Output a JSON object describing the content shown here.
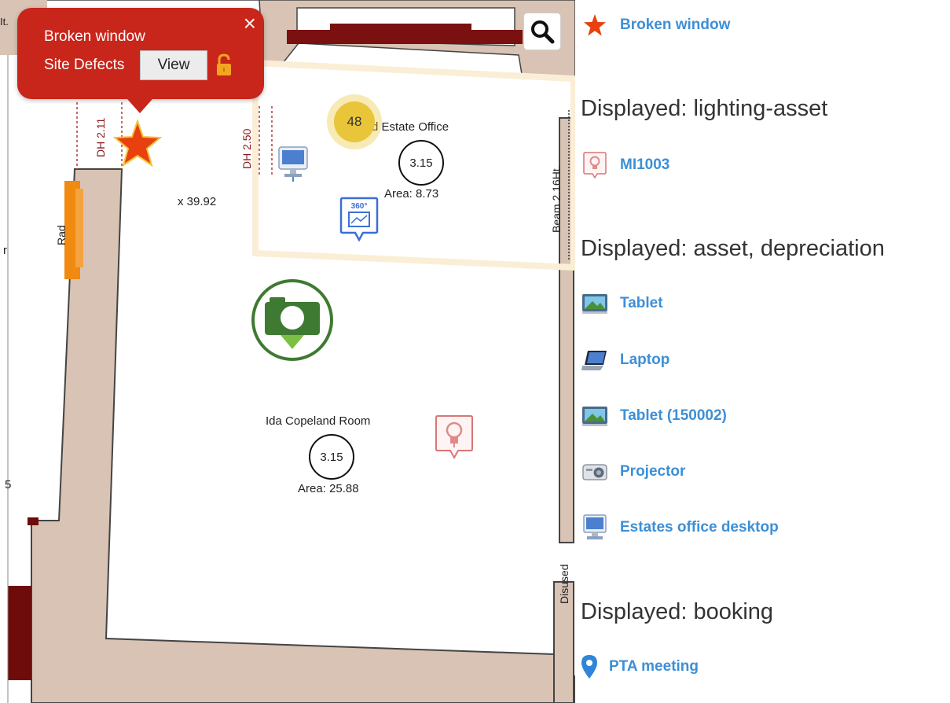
{
  "map": {
    "rooms": [
      {
        "name": "Old Estate Office",
        "value": "3.15",
        "area": "Area: 8.73"
      },
      {
        "name": "Ida Copeland Room",
        "value": "3.15",
        "area": "Area: 25.88"
      }
    ],
    "cluster_count": "48",
    "labels": {
      "dh_left": "DH 2.11",
      "dh_right": "DH 2.50",
      "beam": "Beam 2.16Ht.",
      "rad": "Rad",
      "dimension": "x 39.92",
      "disused": "Disused",
      "edge_top": "It.",
      "edge_r": "r",
      "edge_5": "5"
    },
    "pano_label": "360°",
    "popup": {
      "title": "Broken window",
      "layer": "Site Defects",
      "view_label": "View",
      "close_label": "×"
    }
  },
  "panel": {
    "items_top": [
      {
        "label": "Broken window",
        "icon": "star-icon"
      }
    ],
    "sections": [
      {
        "heading": "Displayed: lighting-asset",
        "items": [
          {
            "label": "MI1003",
            "icon": "lightbulb-marker-icon"
          }
        ]
      },
      {
        "heading": "Displayed: asset, depreciation",
        "items": [
          {
            "label": "Tablet",
            "icon": "tablet-icon"
          },
          {
            "label": "Laptop",
            "icon": "laptop-icon"
          },
          {
            "label": "Tablet (150002)",
            "icon": "tablet-icon"
          },
          {
            "label": "Projector",
            "icon": "projector-icon"
          },
          {
            "label": "Estates office desktop",
            "icon": "desktop-icon"
          }
        ]
      },
      {
        "heading": "Displayed: booking",
        "items": [
          {
            "label": "PTA meeting",
            "icon": "location-pin-icon"
          }
        ]
      }
    ]
  },
  "colors": {
    "wall": "#d8c3b4",
    "dark_wall": "#6e0c0c",
    "popup": "#c8261a",
    "link": "#3d8fd6",
    "camera_green": "#3f7a32",
    "radiator": "#f08a10"
  }
}
